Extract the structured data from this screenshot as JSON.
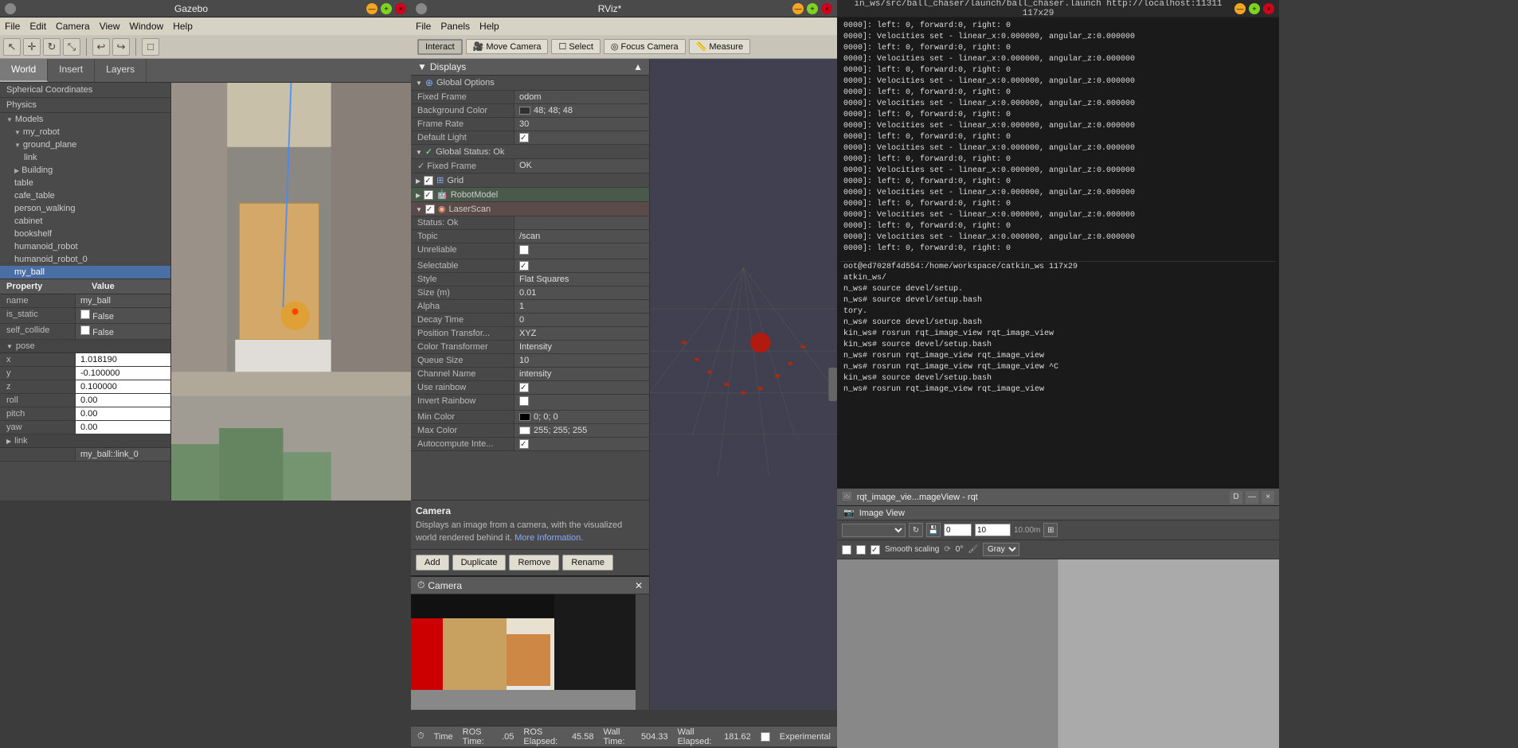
{
  "gazebo": {
    "title": "Gazebo",
    "menu": [
      "File",
      "Edit",
      "Camera",
      "View",
      "Window",
      "Help"
    ],
    "tabs": [
      "World",
      "Insert",
      "Layers"
    ],
    "active_tab": "World",
    "sidebar": {
      "sections": [
        "Spherical Coordinates",
        "Physics"
      ],
      "models_label": "Models",
      "models": [
        {
          "label": "my_robot",
          "indent": 1,
          "expanded": true
        },
        {
          "label": "ground_plane",
          "indent": 1,
          "expanded": true
        },
        {
          "label": "link",
          "indent": 2
        },
        {
          "label": "Building",
          "indent": 1,
          "expanded": false
        },
        {
          "label": "table",
          "indent": 1
        },
        {
          "label": "cafe_table",
          "indent": 1
        },
        {
          "label": "person_walking",
          "indent": 1
        },
        {
          "label": "cabinet",
          "indent": 1
        },
        {
          "label": "bookshelf",
          "indent": 1
        },
        {
          "label": "humanoid_robot",
          "indent": 1
        },
        {
          "label": "humanoid_robot_0",
          "indent": 1
        },
        {
          "label": "my_ball",
          "indent": 1,
          "selected": true
        }
      ]
    },
    "properties": {
      "header": [
        "Property",
        "Value"
      ],
      "rows": [
        {
          "name": "name",
          "value": "my_ball",
          "type": "text"
        },
        {
          "name": "is_static",
          "value": "False",
          "type": "checkbox"
        },
        {
          "name": "self_collide",
          "value": "False",
          "type": "checkbox"
        }
      ],
      "sections": [
        {
          "label": "pose",
          "expanded": true,
          "rows": [
            {
              "name": "x",
              "value": "1.018190",
              "type": "editable"
            },
            {
              "name": "y",
              "value": "-0.100000",
              "type": "editable"
            },
            {
              "name": "z",
              "value": "0.100000",
              "type": "editable"
            },
            {
              "name": "roll",
              "value": "0.00",
              "type": "editable"
            },
            {
              "name": "pitch",
              "value": "0.00",
              "type": "editable"
            },
            {
              "name": "yaw",
              "value": "0.00",
              "type": "editable"
            }
          ]
        },
        {
          "label": "link",
          "expanded": false,
          "rows": [
            {
              "name": "",
              "value": "my_ball::link_0",
              "type": "text"
            }
          ]
        }
      ]
    }
  },
  "rviz": {
    "title": "RViz*",
    "menu": [
      "File",
      "Panels",
      "Help"
    ],
    "toolbar": {
      "buttons": [
        "Interact",
        "Move Camera",
        "Select",
        "Focus Camera",
        "Measure"
      ]
    },
    "displays": {
      "title": "Displays",
      "items": [
        {
          "label": "Global Options",
          "expanded": true,
          "icon": "globe",
          "props": [
            {
              "name": "Fixed Frame",
              "value": "odom"
            },
            {
              "name": "Background Color",
              "value": "48; 48; 48",
              "has_swatch": true,
              "swatch_color": "#303030"
            },
            {
              "name": "Frame Rate",
              "value": "30"
            },
            {
              "name": "Default Light",
              "value": "✓",
              "checked": true
            }
          ]
        },
        {
          "label": "Global Status: Ok",
          "expanded": true,
          "props": [
            {
              "name": "✓ Fixed Frame",
              "value": "OK"
            }
          ]
        },
        {
          "label": "Grid",
          "checked": true,
          "icon": "grid"
        },
        {
          "label": "RobotModel",
          "checked": true,
          "icon": "robot",
          "highlighted": true
        },
        {
          "label": "LaserScan",
          "checked": true,
          "icon": "laser",
          "highlighted": true,
          "expanded": true,
          "props": [
            {
              "name": "Status: Ok",
              "value": ""
            },
            {
              "name": "Topic",
              "value": "/scan"
            },
            {
              "name": "Unreliable",
              "value": "",
              "checkbox": true,
              "checked": false
            },
            {
              "name": "Selectable",
              "value": "✓",
              "checkbox": true,
              "checked": true
            },
            {
              "name": "Style",
              "value": "Flat Squares"
            },
            {
              "name": "Size (m)",
              "value": "0.01"
            },
            {
              "name": "Alpha",
              "value": "1"
            },
            {
              "name": "Decay Time",
              "value": "0"
            },
            {
              "name": "Position Transfor...",
              "value": "XYZ"
            },
            {
              "name": "Color Transformer",
              "value": "Intensity"
            },
            {
              "name": "Queue Size",
              "value": "10"
            },
            {
              "name": "Channel Name",
              "value": "intensity"
            },
            {
              "name": "Use rainbow",
              "value": "✓",
              "checkbox": true,
              "checked": true
            },
            {
              "name": "Invert Rainbow",
              "value": "",
              "checkbox": true,
              "checked": false
            },
            {
              "name": "Min Color",
              "value": "0; 0; 0",
              "has_swatch": true,
              "swatch_color": "#000000"
            },
            {
              "name": "Max Color",
              "value": "255; 255; 255",
              "has_swatch": true,
              "swatch_color": "#ffffff"
            },
            {
              "name": "Autocompute Inte...",
              "value": "✓",
              "checkbox": true,
              "checked": true
            }
          ]
        }
      ],
      "buttons": [
        "Add",
        "Duplicate",
        "Remove",
        "Rename"
      ]
    },
    "camera": {
      "title": "Camera",
      "description": "Displays an image from a camera, with the visualized world rendered behind it.",
      "link_text": "More Information."
    },
    "time": {
      "label": "Time",
      "ros_time_label": "ROS Time:",
      "ros_time": ".05",
      "ros_elapsed_label": "ROS Elapsed:",
      "ros_elapsed": "45.58",
      "wall_time_label": "Wall Time:",
      "wall_time": "504.33",
      "wall_elapsed_label": "Wall Elapsed:",
      "wall_elapsed": "181.62",
      "experimental_label": "Experimental"
    }
  },
  "terminal": {
    "title": "ball_chaser.launch http://localhost:11311 117x29",
    "port": "11311",
    "lines": [
      "0000]: left: 0, forward:0, right: 0",
      "0000]: Velocities set - linear_x:0.000000, angular_z:0.000000",
      "0000]: left: 0, forward:0, right: 0",
      "0000]: Velocities set - linear_x:0.000000, angular_z:0.000000",
      "0000]: left: 0, forward:0, right: 0",
      "0000]: Velocities set - linear_x:0.000000, angular_z:0.000000",
      "0000]: left: 0, forward:0, right: 0",
      "0000]: Velocities set - linear_x:0.000000, angular_z:0.000000",
      "0000]: left: 0, forward:0, right: 0",
      "0000]: Velocities set - linear_x:0.000000, angular_z:0.000000",
      "0000]: left: 0, forward:0, right: 0",
      "0000]: Velocities set - linear_x:0.000000, angular_z:0.000000",
      "0000]: left: 0, forward:0, right: 0",
      "0000]: Velocities set - linear_x:0.000000, angular_z:0.000000",
      "0000]: left: 0, forward:0, right: 0",
      "0000]: Velocities set - linear_x:0.000000, angular_z:0.000000",
      "0000]: left: 0, forward:0, right: 0",
      "0000]: Velocities set - linear_x:0.000000, angular_z:0.000000",
      "0000]: left: 0, forward:0, right: 0",
      "0000]: Velocities set - linear_x:0.000000, angular_z:0.000000",
      "0000]: left: 0, forward:0, right: 0"
    ],
    "bottom_lines": [
      "oot@ed7028f4d554:/home/workspace/catkin_ws 117x29",
      "atkin_ws/",
      "n_ws# source devel/setup.",
      "n_ws# source devel/setup.bash",
      "tory.",
      "n_ws# source devel/setup.bash",
      "kin_ws# rosrun rqt_image_view rqt_image_view",
      "kin_ws# source devel/setup.bash",
      "n_ws# rosrun rqt_image_view rqt_image_view",
      "n_ws# rosrun rqt_image_view rqt_image_view ^C",
      "kin_ws# source devel/setup.bash",
      "n_ws# rosrun rqt_image_view rqt_image_view"
    ]
  },
  "image_view": {
    "title": "rqt_image_vie...mageView - rqt",
    "inner_title": "Image View",
    "smooth_scaling": "Smooth scaling",
    "rotation": "0°",
    "color_mode": "Gray",
    "zoom_value": "0",
    "zoom_max": "10.00m"
  }
}
